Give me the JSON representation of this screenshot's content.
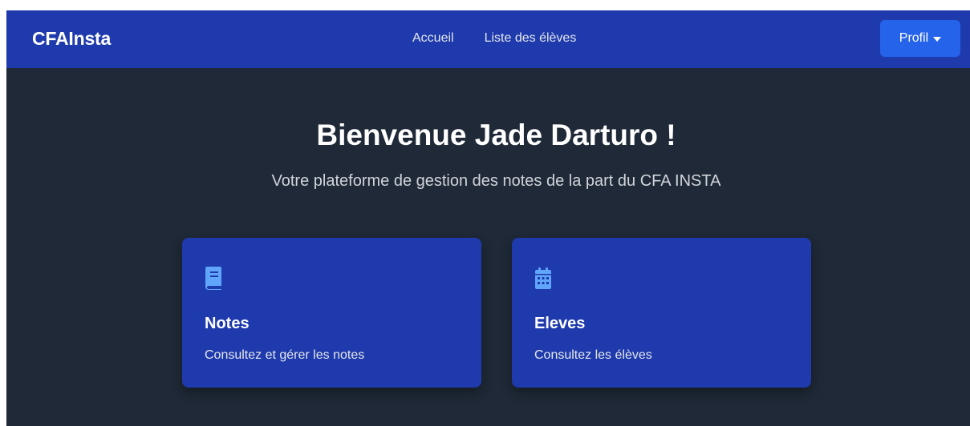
{
  "navbar": {
    "brand": "CFAInsta",
    "links": [
      {
        "label": "Accueil"
      },
      {
        "label": "Liste des élèves"
      }
    ],
    "profile_label": "Profil"
  },
  "hero": {
    "title": "Bienvenue Jade Darturo !",
    "subtitle": "Votre plateforme de gestion des notes de la part du CFA INSTA"
  },
  "cards": [
    {
      "icon": "book-icon",
      "title": "Notes",
      "description": "Consultez et gérer les notes"
    },
    {
      "icon": "calendar-icon",
      "title": "Eleves",
      "description": "Consultez les élèves"
    }
  ],
  "colors": {
    "navbar_bg": "#1e3aad",
    "page_bg": "#1f2937",
    "button_bg": "#2563eb",
    "card_bg": "#1e3aad",
    "icon_color": "#60a5fa"
  }
}
